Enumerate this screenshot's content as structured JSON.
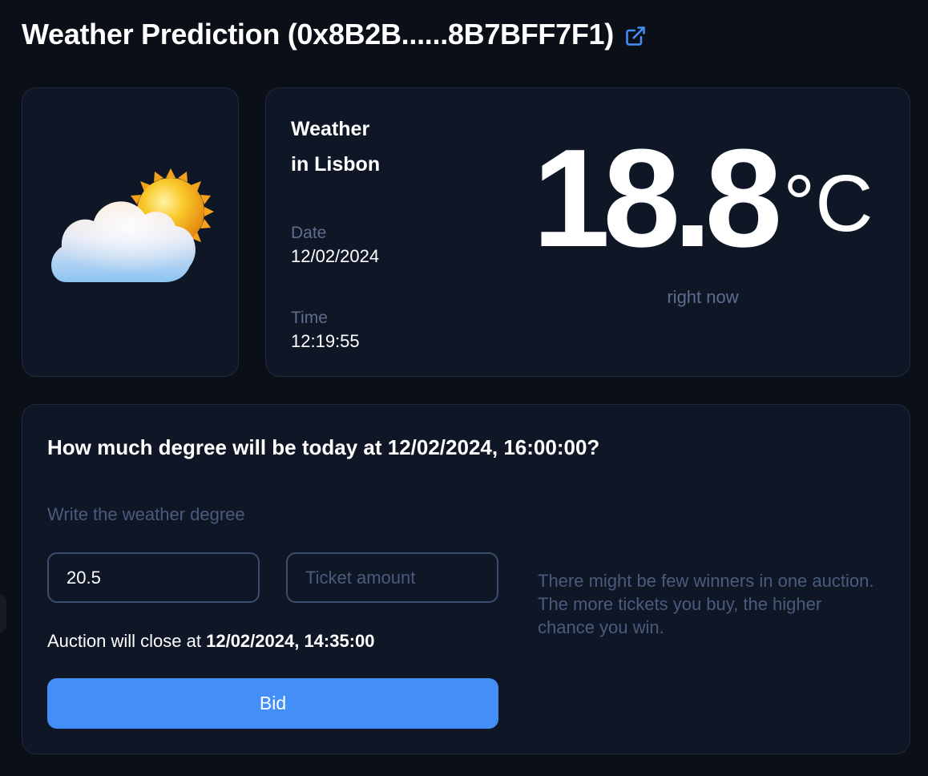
{
  "header": {
    "title": "Weather Prediction (0x8B2B......8B7BFF7F1)",
    "external_link_icon": "external-link-icon",
    "accent_color": "#438ef7"
  },
  "weather_icon": "partly-cloudy-icon",
  "weather": {
    "location_line1": "Weather",
    "location_line2": "in Lisbon",
    "date_label": "Date",
    "date_value": "12/02/2024",
    "time_label": "Time",
    "time_value": "12:19:55",
    "temperature": "18.8",
    "unit": "°C",
    "caption": "right now"
  },
  "prediction": {
    "question": "How much degree will be today at 12/02/2024, 16:00:00?",
    "input_label": "Write the weather degree",
    "degree_value": "20.5",
    "degree_placeholder": "",
    "ticket_value": "",
    "ticket_placeholder": "Ticket amount",
    "close_prefix": "Auction will close at",
    "close_datetime": "12/02/2024, 14:35:00",
    "bid_label": "Bid",
    "bid_color": "#438ef7",
    "hint_line1": "There might be few winners in one auction.",
    "hint_line2": "The more tickets you buy, the higher chance you win."
  }
}
